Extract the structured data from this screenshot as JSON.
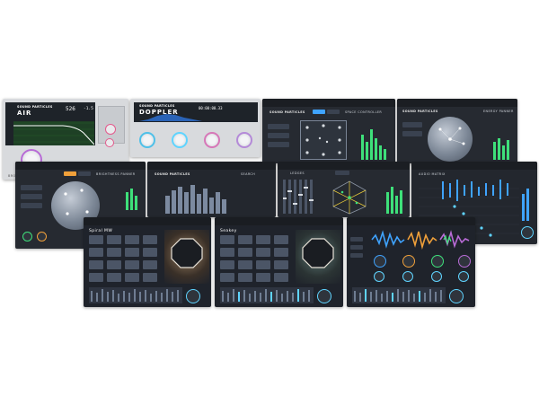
{
  "air": {
    "brand": "SOUND PARTICLES",
    "product": "AIR",
    "readout_main": "526",
    "readout_side": "-1.5",
    "footer_label": "BROWSER"
  },
  "doppler": {
    "brand": "SOUND PARTICLES",
    "product": "DOPPLER",
    "timecode": "00:00:00.33"
  },
  "space_controller": {
    "brand": "SOUND PARTICLES",
    "title": "SPACE CONTROLLER"
  },
  "energy_panner": {
    "brand": "SOUND PARTICLES",
    "title": "ENERGY PANNER"
  },
  "brightness_panner": {
    "title": "BRIGHTNESS PANNER"
  },
  "sp_strip": {
    "brand": "SOUND PARTICLES",
    "title": "SEARCH"
  },
  "inner_panel": {
    "tab": "LEDGES"
  },
  "audio_matrix": {
    "title": "AUDIO MATRIX"
  },
  "spiral_mw": {
    "title": "Spiral MW"
  },
  "seakey": {
    "title": "Seakey"
  },
  "colors": {
    "dark_bg": "#1f232b",
    "panel_bg": "#2a2f38",
    "light_bg": "#d8dadd",
    "accent_blue": "#3fa3ff",
    "accent_green": "#3ee07a",
    "accent_pink": "#e46aa8",
    "accent_orange": "#f0a03a",
    "accent_cyan": "#5fd4ff"
  }
}
